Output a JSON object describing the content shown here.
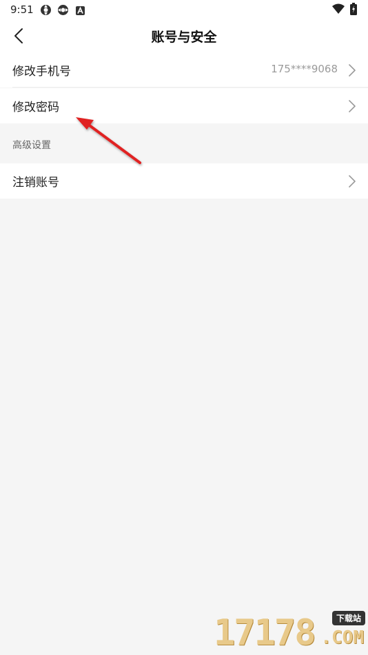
{
  "status_bar": {
    "time": "9:51",
    "icons_left": [
      "sync-icon",
      "sync-icon",
      "a-badge-icon"
    ],
    "icons_right": [
      "wifi-icon",
      "battery-icon"
    ]
  },
  "nav": {
    "back_icon": "chevron-left-icon",
    "title": "账号与安全"
  },
  "rows": [
    {
      "label": "修改手机号",
      "value": "175****9068",
      "icon": "chevron-right-icon"
    },
    {
      "label": "修改密码",
      "value": "",
      "icon": "chevron-right-icon"
    }
  ],
  "section_advanced": {
    "header": "高级设置",
    "rows": [
      {
        "label": "注销账号",
        "icon": "chevron-right-icon"
      }
    ]
  },
  "annotation": {
    "color": "#e02020",
    "target": "修改密码"
  },
  "watermark": {
    "logo": "17178",
    "badge": "下载站",
    "suffix": ".COM"
  },
  "colors": {
    "background": "#f5f5f5",
    "row_background": "#ffffff",
    "value_text": "#9a9a9a"
  }
}
